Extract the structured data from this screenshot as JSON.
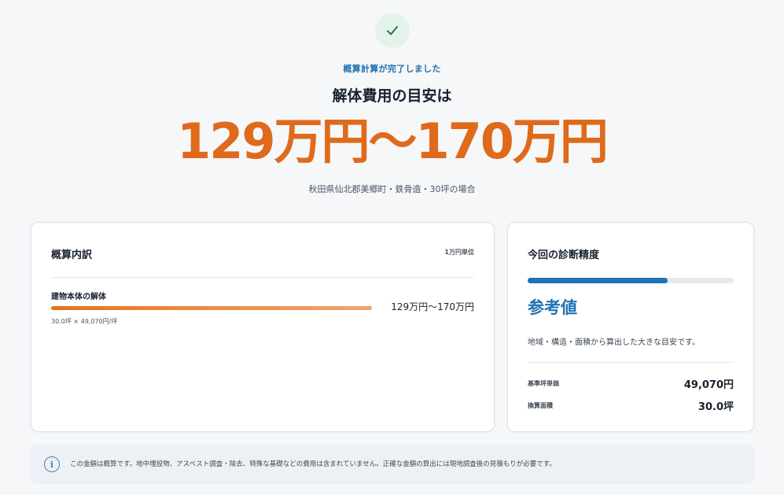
{
  "status": {
    "complete_label": "概算計算が完了しました",
    "check_icon": "check-icon",
    "check_color": "#1e7a4a"
  },
  "result": {
    "headline": "解体費用の目安は",
    "price_range": "129万円〜170万円",
    "condition": "秋田県仙北郡美郷町・鉄骨造・30坪の場合"
  },
  "breakdown": {
    "title": "概算内訳",
    "unit_note": "1万円単位",
    "items": [
      {
        "name": "建物本体の解体",
        "formula": "30.0坪 × 49,070円/坪",
        "amount": "129万円〜170万円",
        "share": 1.0
      }
    ]
  },
  "accuracy": {
    "title": "今回の診断精度",
    "level": 0.68,
    "level_label": "参考値",
    "description": "地域・構造・面積から算出した大きな目安です。",
    "rows": [
      {
        "label": "基準坪単価",
        "value": "49,070円"
      },
      {
        "label": "換算面積",
        "value": "30.0坪"
      }
    ]
  },
  "notice": {
    "icon": "info-icon",
    "text": "この金額は概算です。地中埋設物、アスベスト調査・除去、特殊な基礎などの費用は含まれていません。正確な金額の算出には現地調査後の見積もりが必要です。"
  },
  "colors": {
    "accent_orange": "#e06a1b",
    "accent_blue": "#1f72b3",
    "background": "#f5f7f9"
  }
}
